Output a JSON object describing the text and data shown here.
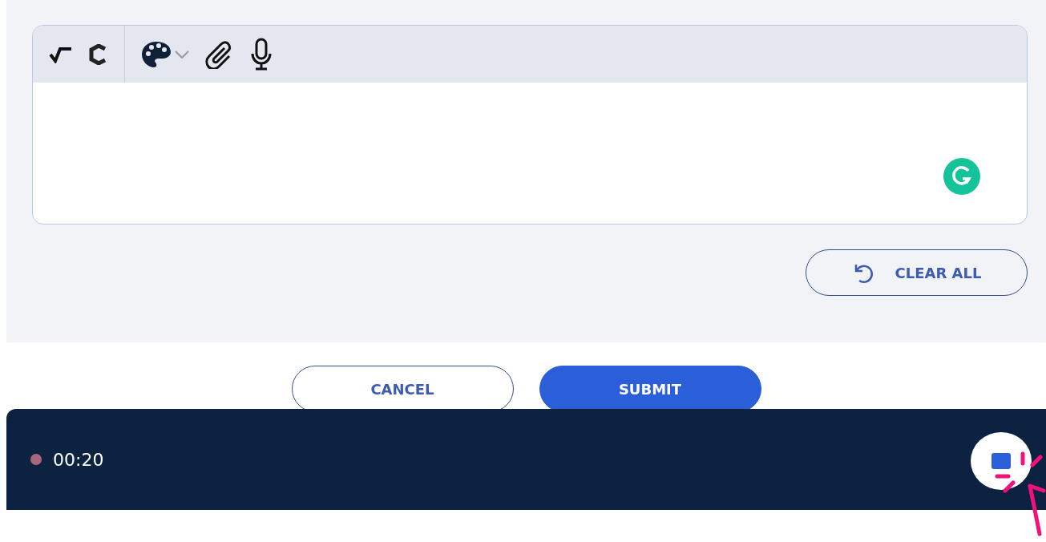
{
  "editor": {
    "toolbar": [
      {
        "kind": "sqrt"
      },
      {
        "kind": "chem"
      },
      {
        "kind": "palette"
      },
      {
        "kind": "attach"
      },
      {
        "kind": "mic"
      }
    ]
  },
  "clear_button": {
    "label": "CLEAR ALL"
  },
  "actions": [
    {
      "label": "CANCEL",
      "kind": "secondary"
    },
    {
      "label": "SUBMIT",
      "kind": "primary"
    }
  ],
  "recorder": {
    "time": "00:20"
  }
}
